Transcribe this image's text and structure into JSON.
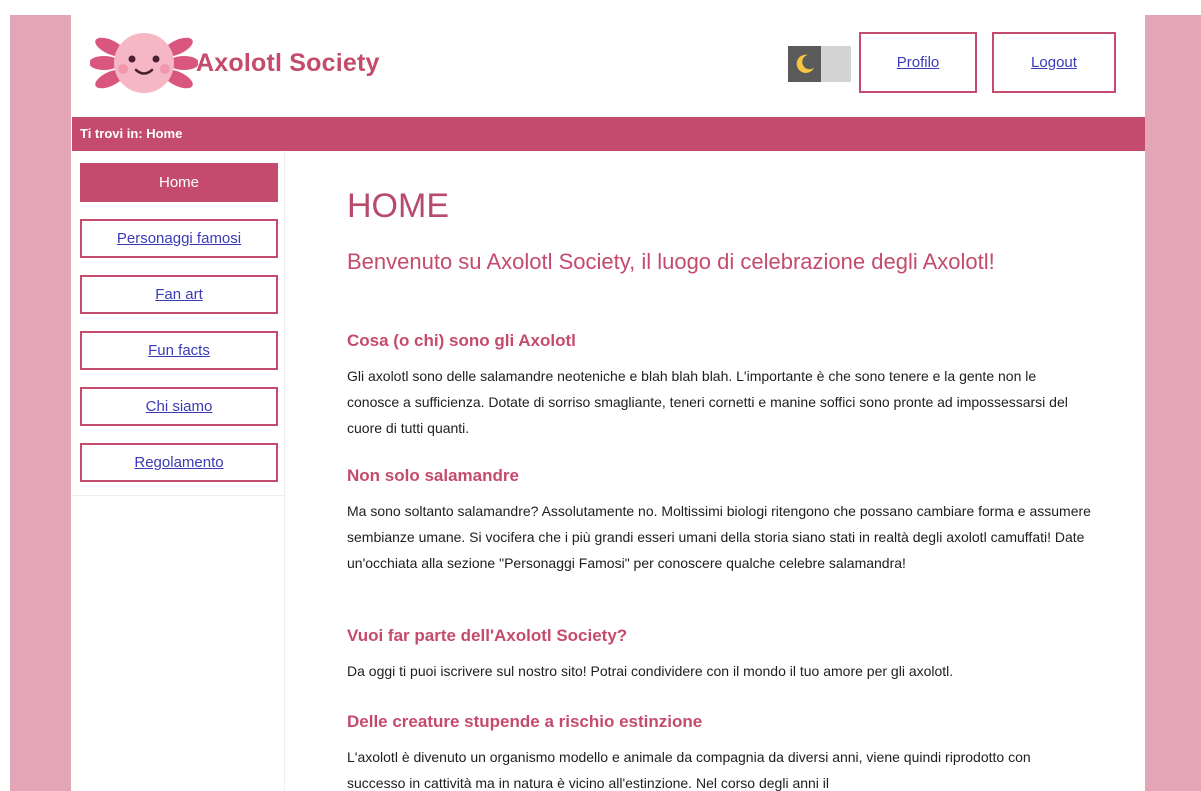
{
  "site": {
    "title": "Axolotl Society"
  },
  "header": {
    "theme_toggle_icon": "moon-icon",
    "profile_label": "Profilo",
    "logout_label": "Logout"
  },
  "breadcrumb": {
    "text": "Ti trovi in: Home"
  },
  "sidebar": {
    "items": [
      {
        "label": "Home",
        "active": true
      },
      {
        "label": "Personaggi famosi",
        "active": false
      },
      {
        "label": "Fan art",
        "active": false
      },
      {
        "label": "Fun facts",
        "active": false
      },
      {
        "label": "Chi siamo",
        "active": false
      },
      {
        "label": "Regolamento",
        "active": false
      }
    ]
  },
  "main": {
    "heading": "HOME",
    "intro": "Benvenuto su Axolotl Society, il luogo di celebrazione degli Axolotl!",
    "sections": [
      {
        "title": "Cosa (o chi) sono gli Axolotl",
        "text": "Gli axolotl sono delle salamandre neoteniche e blah blah blah. L'importante è che sono tenere e la gente non le conosce a sufficienza. Dotate di sorriso smagliante, teneri cornetti e manine soffici sono pronte ad impossessarsi del cuore di tutti quanti."
      },
      {
        "title": "Non solo salamandre",
        "text": "Ma sono soltanto salamandre? Assolutamente no. Moltissimi biologi ritengono che possano cambiare forma e assumere sembianze umane. Si vocifera che i più grandi esseri umani della storia siano stati in realtà degli axolotl camuffati! Date un'occhiata alla sezione \"Personaggi Famosi\" per conoscere qualche celebre salamandra!"
      },
      {
        "title": "Vuoi far parte dell'Axolotl Society?",
        "text": "Da oggi ti puoi iscrivere sul nostro sito! Potrai condividere con il mondo il tuo amore per gli axolotl."
      },
      {
        "title": "Delle creature stupende a rischio estinzione",
        "text": "L'axolotl è divenuto un organismo modello e animale da compagnia da diversi anni, viene quindi riprodotto con successo in cattività ma in natura è vicino all'estinzione. Nel corso degli anni il"
      }
    ]
  },
  "colors": {
    "accent": "#c44b6e",
    "side_band": "#e2a6b6",
    "link": "#3b3bb8"
  }
}
